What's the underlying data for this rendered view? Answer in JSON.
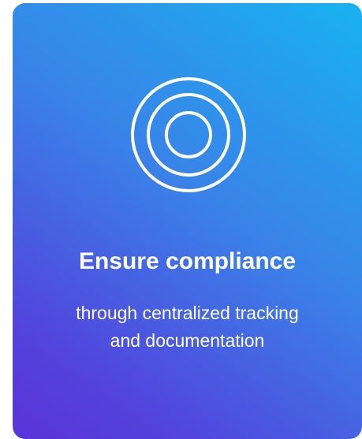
{
  "card": {
    "icon": "target-icon",
    "title": "Ensure compliance",
    "subtitle": "through centralized tracking and documentation"
  },
  "colors": {
    "gradient_top_right": "#18b2f0",
    "gradient_bottom_left": "#5a34da",
    "text": "#ffffff"
  }
}
